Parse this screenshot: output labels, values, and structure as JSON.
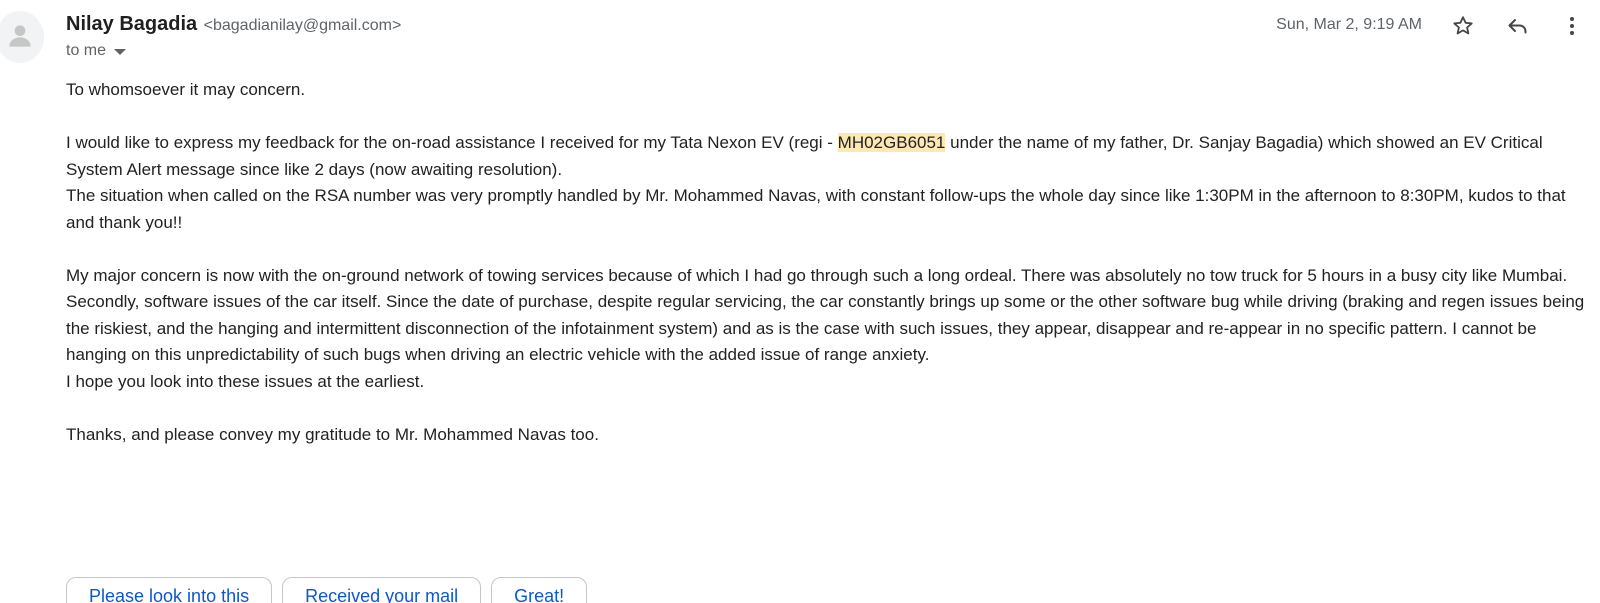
{
  "message": {
    "sender_name": "Nilay Bagadia",
    "sender_email": "<bagadianilay@gmail.com>",
    "to_label": "to me",
    "date": "Sun, Mar 2, 9:19 AM",
    "icons": [
      "person-icon",
      "star-icon",
      "reply-icon",
      "more-vert-icon",
      "caret-down-icon"
    ]
  },
  "body": {
    "greeting": "To whomsoever it may concern.",
    "p1_before": "I would like to express my feedback for the on-road assistance I received for my Tata Nexon EV (regi - ",
    "p1_highlight": "MH02GB6051",
    "p1_after": " under the name of my father, Dr. Sanjay Bagadia) which showed an EV Critical System Alert message since like 2 days (now awaiting resolution).",
    "p2": "The situation when called on the RSA number was very promptly handled by Mr. Mohammed Navas, with constant follow-ups the whole day since like 1:30PM in the afternoon to 8:30PM, kudos to that and thank you!!",
    "p3": "My major concern is now with the on-ground network of towing services because of which I had go through such a long ordeal. There was absolutely no tow truck for 5 hours in a busy city like Mumbai.",
    "p4": "Secondly, software issues of the car itself. Since the date of purchase, despite regular servicing, the car constantly brings up some or the other software bug while driving (braking and regen issues being the riskiest, and the hanging and intermittent disconnection of the infotainment system)  and as is the case with such issues, they appear, disappear and re-appear in no specific pattern. I cannot be hanging on this unpredictability of such bugs when driving an electric vehicle with the added issue of range anxiety.",
    "p5": "I hope you look into these issues at the earliest.",
    "p6": "Thanks, and please convey my gratitude to Mr. Mohammed Navas too."
  },
  "smart_replies": [
    "Please look into this",
    "Received your mail",
    "Great!"
  ],
  "colors": {
    "highlight": "#fce8b2",
    "chip_text": "#0b57d0",
    "meta_text": "#5f6368"
  }
}
